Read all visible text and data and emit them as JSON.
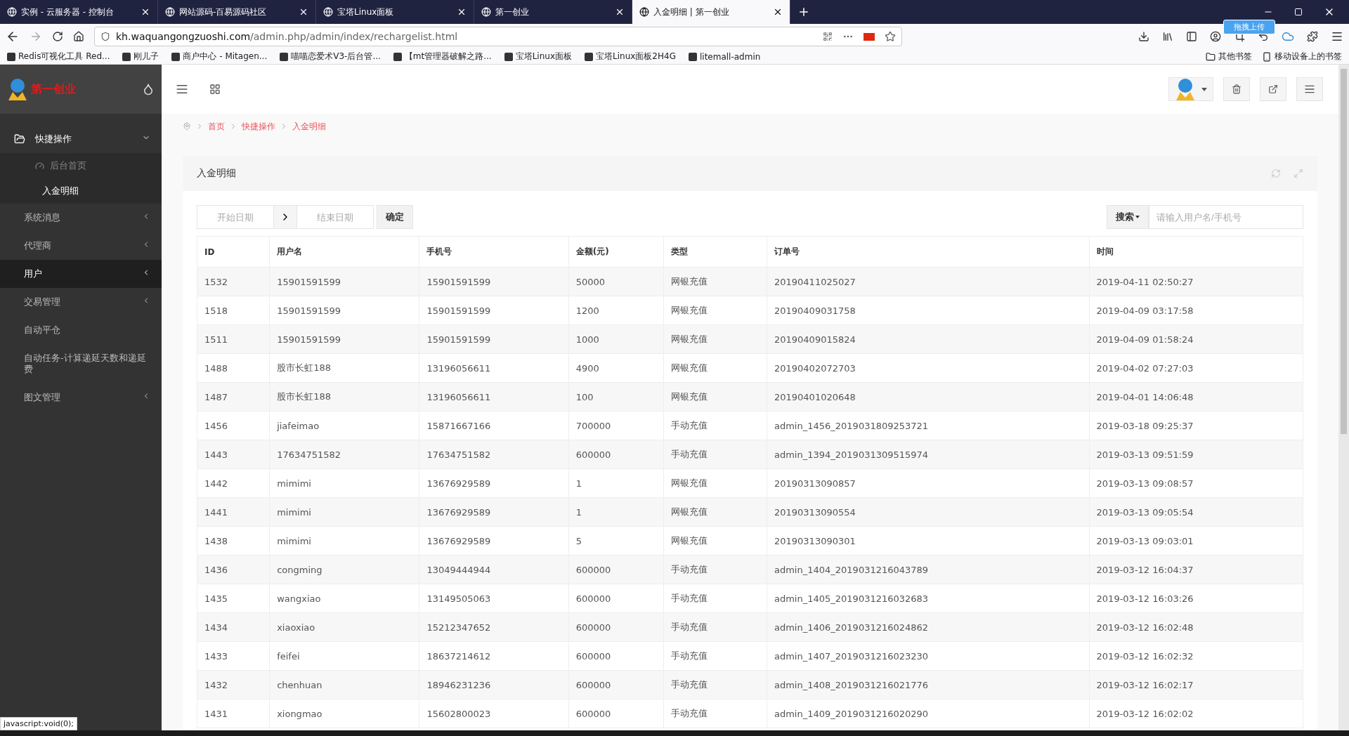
{
  "browser": {
    "tabs": [
      {
        "title": "实例 - 云服务器 - 控制台",
        "selected": false
      },
      {
        "title": "网站源码-百易源码社区",
        "selected": false
      },
      {
        "title": "宝塔Linux面板",
        "selected": false
      },
      {
        "title": "第一创业",
        "selected": false
      },
      {
        "title": "入金明细 | 第一创业",
        "selected": true
      }
    ],
    "address": {
      "domain": "kh.waquangongzuoshi.com",
      "path": "/admin.php/admin/index/rechargelist.html"
    },
    "extension_tooltip": "拖拽上传",
    "bookmarks": [
      "Redis可视化工具 Red...",
      "刚儿子",
      "商户中心 - Mitagen...",
      "喵喵恋爱术V3-后台管...",
      "【mt管理器破解之路...",
      "宝塔Linux面板",
      "宝塔Linux面板2H4G",
      "litemall-admin"
    ],
    "bookmark_folders": [
      "其他书签",
      "移动设备上的书签"
    ],
    "status_text": "javascript:void(0);"
  },
  "sidebar": {
    "brand": "第一创业",
    "items": [
      {
        "label": "快捷操作",
        "expanded": true,
        "highlighted": false,
        "children": [
          {
            "label": "后台首页",
            "selected": false
          },
          {
            "label": "入金明细",
            "selected": true
          }
        ]
      },
      {
        "label": "系统消息",
        "expanded": false,
        "highlighted": false
      },
      {
        "label": "代理商",
        "expanded": false,
        "highlighted": false
      },
      {
        "label": "用户",
        "expanded": false,
        "highlighted": true
      },
      {
        "label": "交易管理",
        "expanded": false,
        "highlighted": false
      },
      {
        "label": "自动平仓",
        "highlighted": false
      },
      {
        "label": "自动任务-计算递延天数和递延费",
        "highlighted": false
      },
      {
        "label": "图文管理",
        "expanded": false,
        "highlighted": false
      }
    ]
  },
  "breadcrumb": [
    "首页",
    "快捷操作",
    "入金明细"
  ],
  "card": {
    "title": "入金明细",
    "filters": {
      "start_placeholder": "开始日期",
      "end_placeholder": "结束日期",
      "confirm": "确定",
      "search_button": "搜索",
      "search_placeholder": "请输入用户名/手机号"
    },
    "table": {
      "columns": [
        "ID",
        "用户名",
        "手机号",
        "金额(元)",
        "类型",
        "订单号",
        "时间"
      ],
      "rows": [
        [
          "1532",
          "15901591599",
          "15901591599",
          "50000",
          "网银充值",
          "20190411025027",
          "2019-04-11 02:50:27"
        ],
        [
          "1518",
          "15901591599",
          "15901591599",
          "1200",
          "网银充值",
          "20190409031758",
          "2019-04-09 03:17:58"
        ],
        [
          "1511",
          "15901591599",
          "15901591599",
          "1000",
          "网银充值",
          "20190409015824",
          "2019-04-09 01:58:24"
        ],
        [
          "1488",
          "股市长虹188",
          "13196056611",
          "4900",
          "网银充值",
          "20190402072703",
          "2019-04-02 07:27:03"
        ],
        [
          "1487",
          "股市长虹188",
          "13196056611",
          "100",
          "网银充值",
          "20190401020648",
          "2019-04-01 14:06:48"
        ],
        [
          "1456",
          "jiafeimao",
          "15871667166",
          "700000",
          "手动充值",
          "admin_1456_2019031809253721",
          "2019-03-18 09:25:37"
        ],
        [
          "1443",
          "17634751582",
          "17634751582",
          "600000",
          "手动充值",
          "admin_1394_2019031309515974",
          "2019-03-13 09:51:59"
        ],
        [
          "1442",
          "mimimi",
          "13676929589",
          "1",
          "网银充值",
          "20190313090857",
          "2019-03-13 09:08:57"
        ],
        [
          "1441",
          "mimimi",
          "13676929589",
          "1",
          "网银充值",
          "20190313090554",
          "2019-03-13 09:05:54"
        ],
        [
          "1438",
          "mimimi",
          "13676929589",
          "5",
          "网银充值",
          "20190313090301",
          "2019-03-13 09:03:01"
        ],
        [
          "1436",
          "congming",
          "13049444944",
          "600000",
          "手动充值",
          "admin_1404_2019031216043789",
          "2019-03-12 16:04:37"
        ],
        [
          "1435",
          "wangxiao",
          "13149505063",
          "600000",
          "手动充值",
          "admin_1405_2019031216032683",
          "2019-03-12 16:03:26"
        ],
        [
          "1434",
          "xiaoxiao",
          "15212347652",
          "600000",
          "手动充值",
          "admin_1406_2019031216024862",
          "2019-03-12 16:02:48"
        ],
        [
          "1433",
          "feifei",
          "18637214612",
          "600000",
          "手动充值",
          "admin_1407_2019031216023230",
          "2019-03-12 16:02:32"
        ],
        [
          "1432",
          "chenhuan",
          "18946231236",
          "600000",
          "手动充值",
          "admin_1408_2019031216021776",
          "2019-03-12 16:02:17"
        ],
        [
          "1431",
          "xiongmao",
          "15602800023",
          "600000",
          "手动充值",
          "admin_1409_2019031216020290",
          "2019-03-12 16:02:02"
        ]
      ]
    }
  }
}
